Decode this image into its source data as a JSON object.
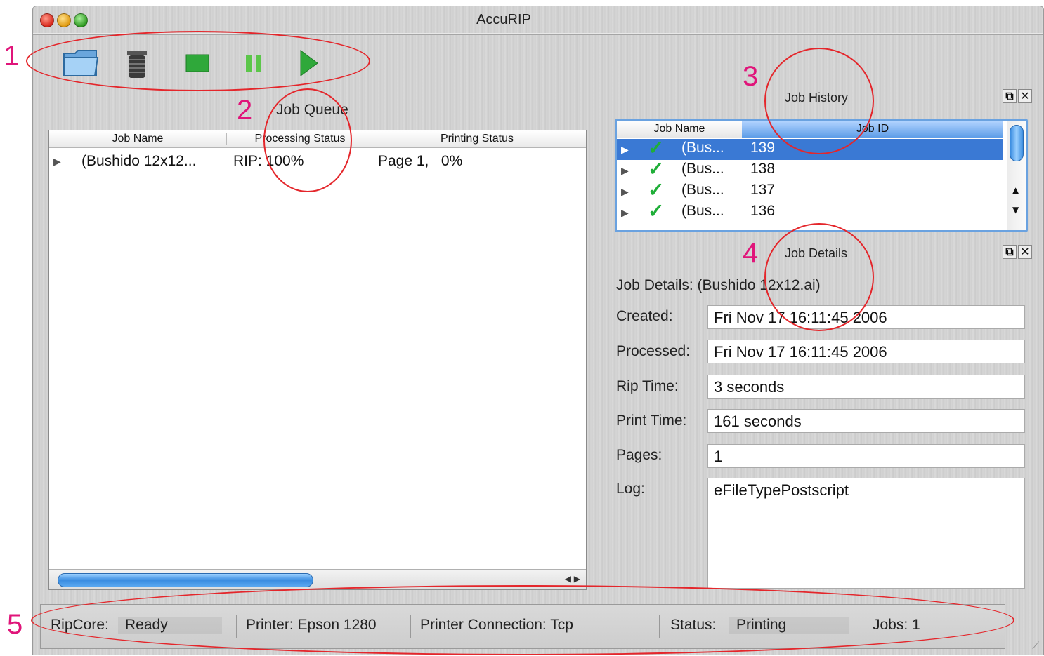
{
  "window": {
    "title": "AccuRIP"
  },
  "toolbar": {
    "buttons": [
      {
        "name": "open-folder-icon",
        "label": ""
      },
      {
        "name": "trash-icon",
        "label": ""
      },
      {
        "name": "stop-icon",
        "label": ""
      },
      {
        "name": "pause-icon",
        "label": ""
      },
      {
        "name": "play-icon",
        "label": ""
      }
    ]
  },
  "job_queue": {
    "title": "Job Queue",
    "columns": [
      "Job Name",
      "Processing Status",
      "Printing Status"
    ],
    "rows": [
      {
        "job_name": "(Bushido 12x12...",
        "processing_status": "RIP: 100%",
        "printing_status": "Page 1,   0%"
      }
    ]
  },
  "job_history": {
    "title": "Job History",
    "columns": [
      "Job Name",
      "Job ID"
    ],
    "rows": [
      {
        "job_name": "(Bus...",
        "job_id": "139",
        "selected": true
      },
      {
        "job_name": "(Bus...",
        "job_id": "138",
        "selected": false
      },
      {
        "job_name": "(Bus...",
        "job_id": "137",
        "selected": false
      },
      {
        "job_name": "(Bus...",
        "job_id": "136",
        "selected": false
      }
    ]
  },
  "job_details": {
    "title": "Job Details",
    "header": "Job Details: (Bushido 12x12.ai)",
    "fields": {
      "created_label": "Created:",
      "created_value": "Fri Nov 17 16:11:45 2006",
      "processed_label": "Processed:",
      "processed_value": "Fri Nov 17 16:11:45 2006",
      "rip_time_label": "Rip Time:",
      "rip_time_value": "3 seconds",
      "print_time_label": "Print Time:",
      "print_time_value": "161 seconds",
      "pages_label": "Pages:",
      "pages_value": "1",
      "log_label": "Log:",
      "log_value": "eFileTypePostscript"
    }
  },
  "status_bar": {
    "ripcore_label": "RipCore:",
    "ripcore_value": "Ready",
    "printer": "Printer: Epson 1280",
    "connection": "Printer Connection: Tcp",
    "status_label": "Status:",
    "status_value": "Printing",
    "jobs": "Jobs: 1"
  },
  "annotations": [
    "1",
    "2",
    "3",
    "4",
    "5"
  ],
  "colors": {
    "annotation_number": "#e0157a",
    "annotation_circle": "#e4262b",
    "selection": "#3a79d4",
    "check": "#1fae38"
  }
}
